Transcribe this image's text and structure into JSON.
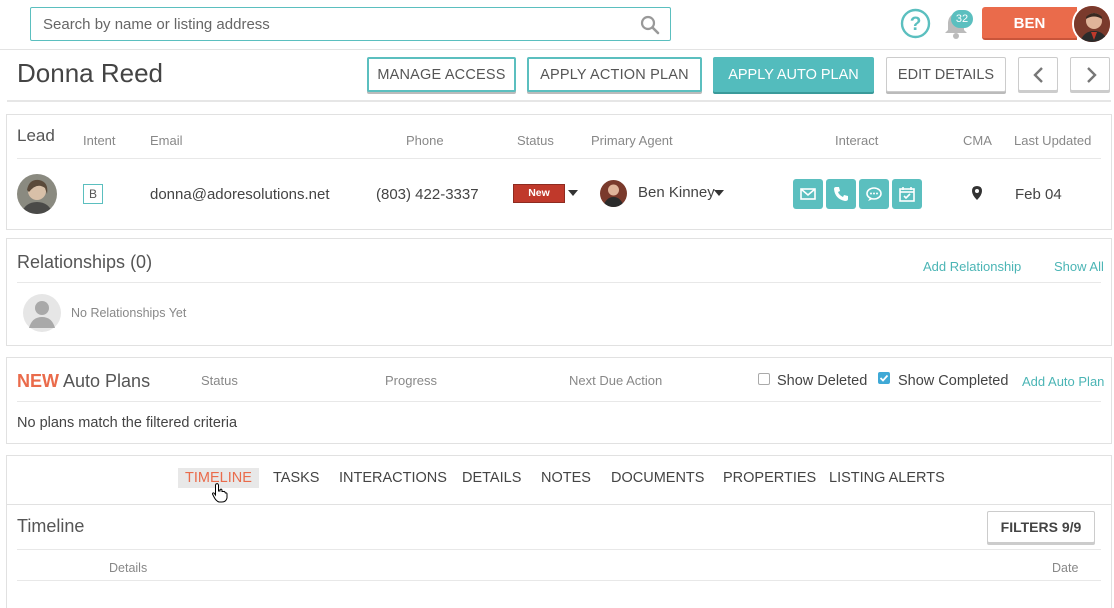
{
  "search": {
    "placeholder": "Search by name or listing address"
  },
  "topbar": {
    "notifications_count": "32",
    "user_label": "BEN"
  },
  "contact": {
    "name": "Donna Reed"
  },
  "actions": {
    "manage_access": "MANAGE ACCESS",
    "apply_action_plan": "APPLY ACTION PLAN",
    "apply_auto_plan": "APPLY AUTO PLAN",
    "edit_details": "EDIT DETAILS"
  },
  "lead": {
    "title": "Lead",
    "headers": {
      "intent": "Intent",
      "email": "Email",
      "phone": "Phone",
      "status": "Status",
      "primary_agent": "Primary Agent",
      "interact": "Interact",
      "cma": "CMA",
      "last_updated": "Last Updated"
    },
    "intent": "B",
    "email": "donna@adoresolutions.net",
    "phone": "(803) 422-3337",
    "status": "New",
    "agent": "Ben Kinney",
    "last_updated": "Feb 04"
  },
  "relationships": {
    "title": "Relationships (0)",
    "add_link": "Add Relationship",
    "show_all": "Show All",
    "empty": "No Relationships Yet"
  },
  "auto_plans": {
    "title_prefix": "NEW",
    "title": "Auto Plans",
    "headers": {
      "status": "Status",
      "progress": "Progress",
      "next_due": "Next Due Action"
    },
    "show_deleted": "Show Deleted",
    "show_completed": "Show Completed",
    "show_deleted_checked": false,
    "show_completed_checked": true,
    "add_link": "Add Auto Plan",
    "empty": "No plans match the filtered criteria"
  },
  "tabs": [
    "TIMELINE",
    "TASKS",
    "INTERACTIONS",
    "DETAILS",
    "NOTES",
    "DOCUMENTS",
    "PROPERTIES",
    "LISTING ALERTS"
  ],
  "timeline": {
    "title": "Timeline",
    "filters": "FILTERS 9/9",
    "headers": {
      "details": "Details",
      "date": "Date"
    }
  },
  "colors": {
    "accent": "#5bbfbf",
    "brand_orange": "#ea6b4b",
    "status_red": "#c0392b"
  }
}
